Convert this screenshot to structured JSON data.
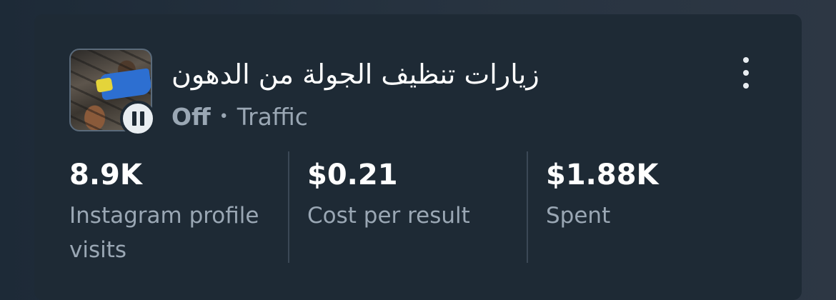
{
  "campaign": {
    "title": "زيارات تنظيف الجولة من الدهون",
    "status": "Off",
    "separator": "•",
    "objective": "Traffic",
    "thumbnail_icon": "pause-icon"
  },
  "metrics": [
    {
      "value": "8.9K",
      "label_line1": "Instagram profile",
      "label_line2": "visits"
    },
    {
      "value": "$0.21",
      "label_line1": "Cost per result",
      "label_line2": ""
    },
    {
      "value": "$1.88K",
      "label_line1": "Spent",
      "label_line2": ""
    }
  ],
  "colors": {
    "card_bg": "#1e2a35",
    "text_primary": "#ffffff",
    "text_secondary": "#9aa7b4"
  }
}
